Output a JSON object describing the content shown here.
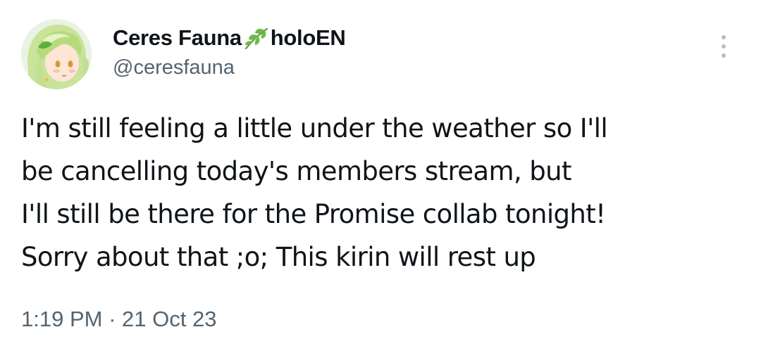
{
  "author": {
    "display_name": "Ceres Fauna",
    "emoji_icon": "herb-leaf-icon",
    "affiliation": "holoEN",
    "handle": "@ceresfauna"
  },
  "tweet": {
    "lines": [
      "I'm still feeling a little under the weather so I'll",
      "be cancelling today's members stream, but",
      "I'll still be there for the Promise collab tonight!",
      "Sorry about that ;o; This kirin will rest up"
    ],
    "time": "1:19 PM",
    "separator": "·",
    "date": "21 Oct 23"
  },
  "colors": {
    "text": "#0f1419",
    "secondary_text": "#536471",
    "leaf_green": "#6dbb4a",
    "more_dots": "#b4bcc4"
  }
}
